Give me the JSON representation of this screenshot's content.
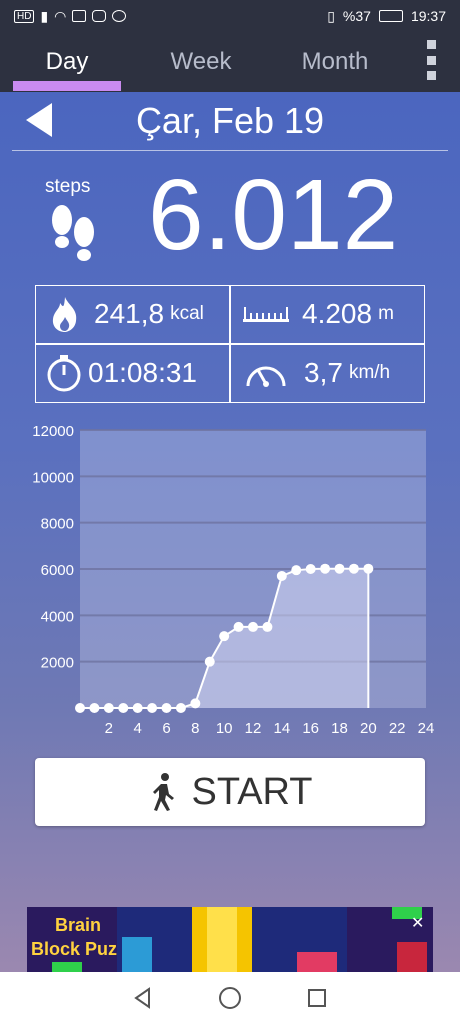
{
  "statusbar": {
    "left_badge": "HD",
    "battery": "%37",
    "time": "19:37"
  },
  "tabs": [
    {
      "label": "Day"
    },
    {
      "label": "Week"
    },
    {
      "label": "Month"
    }
  ],
  "date": {
    "title": "Çar, Feb 19"
  },
  "steps": {
    "label": "steps",
    "value": "6.012"
  },
  "stats": {
    "calories_value": "241,8",
    "calories_unit": "kcal",
    "distance_value": "4.208",
    "distance_unit": "m",
    "duration_value": "01:08:31",
    "speed_value": "3,7",
    "speed_unit": "km/h"
  },
  "chart_data": {
    "type": "area",
    "x": [
      0,
      1,
      2,
      3,
      4,
      5,
      6,
      7,
      8,
      9,
      10,
      11,
      12,
      13,
      14,
      15,
      16,
      17,
      18,
      19,
      20
    ],
    "values": [
      0,
      0,
      0,
      0,
      0,
      0,
      0,
      0,
      200,
      2000,
      3100,
      3500,
      3500,
      3500,
      5700,
      5950,
      6000,
      6012,
      6012,
      6012,
      6012
    ],
    "xticks": [
      "2",
      "4",
      "6",
      "8",
      "10",
      "12",
      "14",
      "16",
      "18",
      "20",
      "22",
      "24"
    ],
    "yticks": [
      "2000",
      "4000",
      "6000",
      "8000",
      "10000",
      "12000"
    ],
    "xlim": [
      0,
      24
    ],
    "ylim": [
      0,
      12000
    ],
    "grid": true
  },
  "start_button": {
    "label": "START"
  },
  "ad": {
    "title_line1": "Brain",
    "title_line2": "Block Puz"
  }
}
